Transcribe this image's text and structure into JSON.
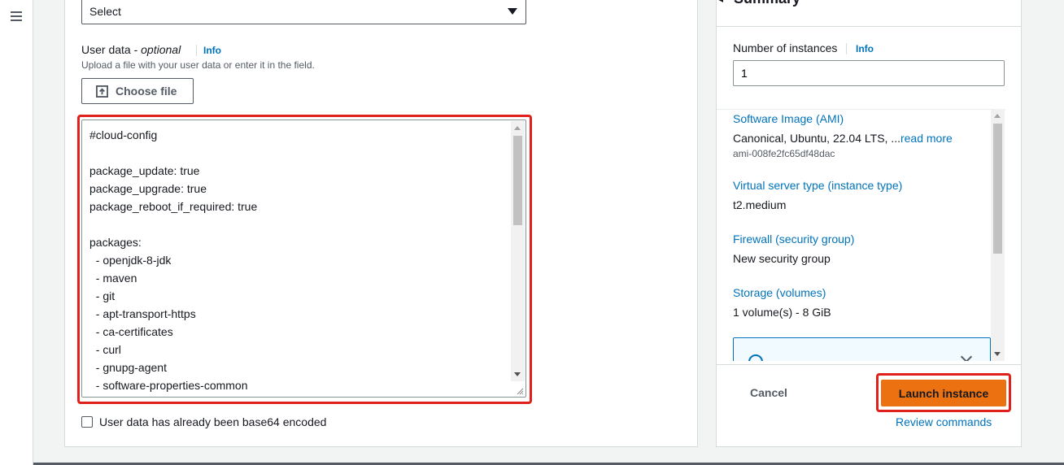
{
  "nav": {
    "menu_icon": "hamburger-menu-icon"
  },
  "main": {
    "select": {
      "value": "Select"
    },
    "user_data": {
      "label": "User data - ",
      "label_optional": "optional",
      "info": "Info",
      "description": "Upload a file with your user data or enter it in the field.",
      "choose_file": "Choose file",
      "choose_file_icon": "upload-icon",
      "content_lines": [
        "#cloud-config",
        "",
        "package_update: true",
        "package_upgrade: true",
        "package_reboot_if_required: true",
        "",
        "packages:",
        "  - openjdk-8-jdk",
        "  - maven",
        "  - git",
        "  - apt-transport-https",
        "  - ca-certificates",
        "  - curl",
        "  - gnupg-agent",
        "  - software-properties-common"
      ],
      "base64_checkbox_label": "User data has already been base64 encoded"
    }
  },
  "summary": {
    "title": "Summary",
    "instances": {
      "label": "Number of instances",
      "info": "Info",
      "value": "1"
    },
    "software_image": {
      "label": "Software Image (AMI)",
      "value": "Canonical, Ubuntu, 22.04 LTS, ...",
      "read_more": "read more",
      "id": "ami-008fe2fc65df48dac"
    },
    "server_type": {
      "label": "Virtual server type (instance type)",
      "value": "t2.medium"
    },
    "firewall": {
      "label": "Firewall (security group)",
      "value": "New security group"
    },
    "storage": {
      "label": "Storage (volumes)",
      "value": "1 volume(s) - 8 GiB"
    },
    "cancel": "Cancel",
    "launch": "Launch instance",
    "review": "Review commands"
  },
  "colors": {
    "launch_button": "#ec7211",
    "highlight_frame": "#e0211b",
    "link": "#0073bb"
  }
}
